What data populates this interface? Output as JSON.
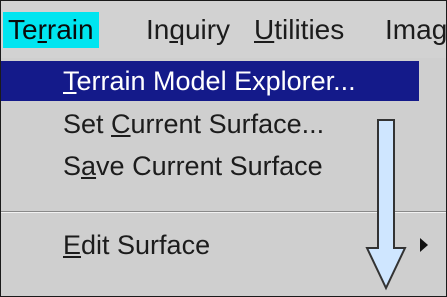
{
  "menubar": {
    "items": [
      {
        "pre": "Te",
        "ul": "r",
        "post": "rain",
        "active": true
      },
      {
        "pre": "In",
        "ul": "q",
        "post": "uiry"
      },
      {
        "pre": "",
        "ul": "U",
        "post": "tilities"
      },
      {
        "pre": "Ima",
        "ul": "g",
        "post": ""
      }
    ]
  },
  "dropdown": {
    "items": [
      {
        "pre": "",
        "ul": "T",
        "post": "errain Model Explorer...",
        "highlighted": true
      },
      {
        "pre": "Set ",
        "ul": "C",
        "post": "urrent Surface..."
      },
      {
        "pre": "S",
        "ul": "a",
        "post": "ve Current Surface"
      },
      {
        "pre": "",
        "ul": "E",
        "post": "dit Surface",
        "has_submenu": true
      }
    ]
  },
  "colors": {
    "menubar_active_bg": "#00e5f0",
    "highlight_bg": "#141a8a",
    "arrow_fill": "#cfe6ff",
    "arrow_stroke": "#333333"
  }
}
